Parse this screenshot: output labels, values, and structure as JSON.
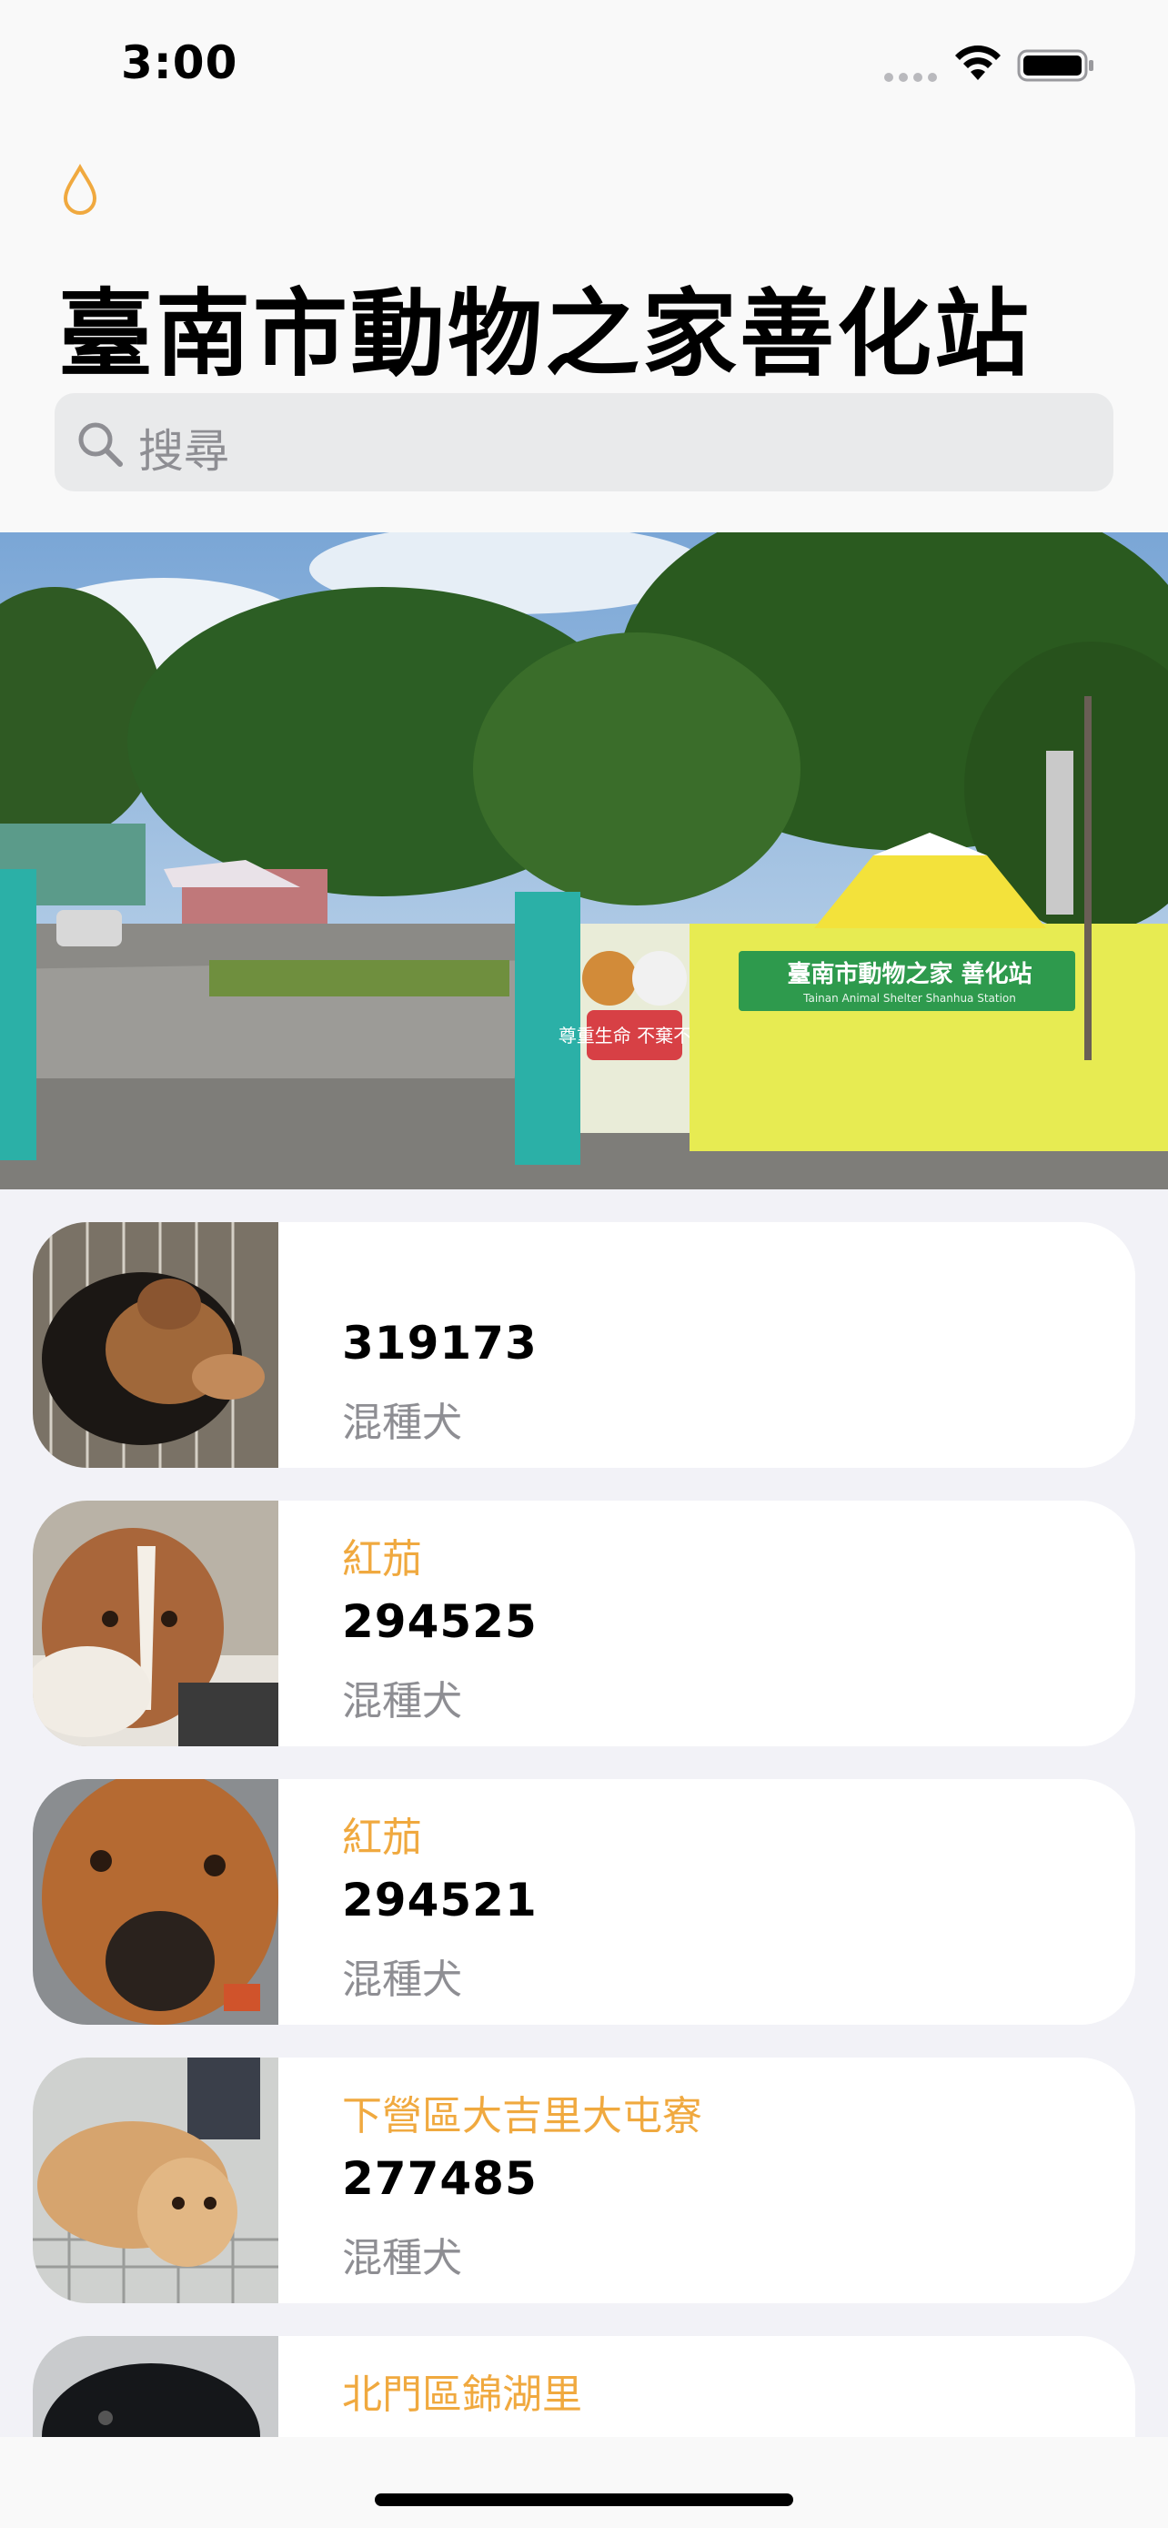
{
  "status_bar": {
    "time": "3:00"
  },
  "header": {
    "icon": "drop-icon",
    "title": "臺南市動物之家善化站",
    "search": {
      "placeholder": "搜尋",
      "icon": "search-icon"
    }
  },
  "hero": {
    "sign_text": "臺南市動物之家 善化站",
    "sign_subtext": "Tainan Animal Shelter Shanhua Station",
    "mural_text": "尊重生命 不棄不養"
  },
  "animals": [
    {
      "location": "",
      "id": "319173",
      "breed": "混種犬"
    },
    {
      "location": "紅茄",
      "id": "294525",
      "breed": "混種犬"
    },
    {
      "location": "紅茄",
      "id": "294521",
      "breed": "混種犬"
    },
    {
      "location": "下營區大吉里大屯寮",
      "id": "277485",
      "breed": "混種犬"
    },
    {
      "location": "北門區錦湖里",
      "id": "",
      "breed": ""
    }
  ],
  "colors": {
    "accent": "#f0a93f",
    "background": "#f2f2f7",
    "card": "#ffffff",
    "secondary_text": "#8e8e93"
  }
}
